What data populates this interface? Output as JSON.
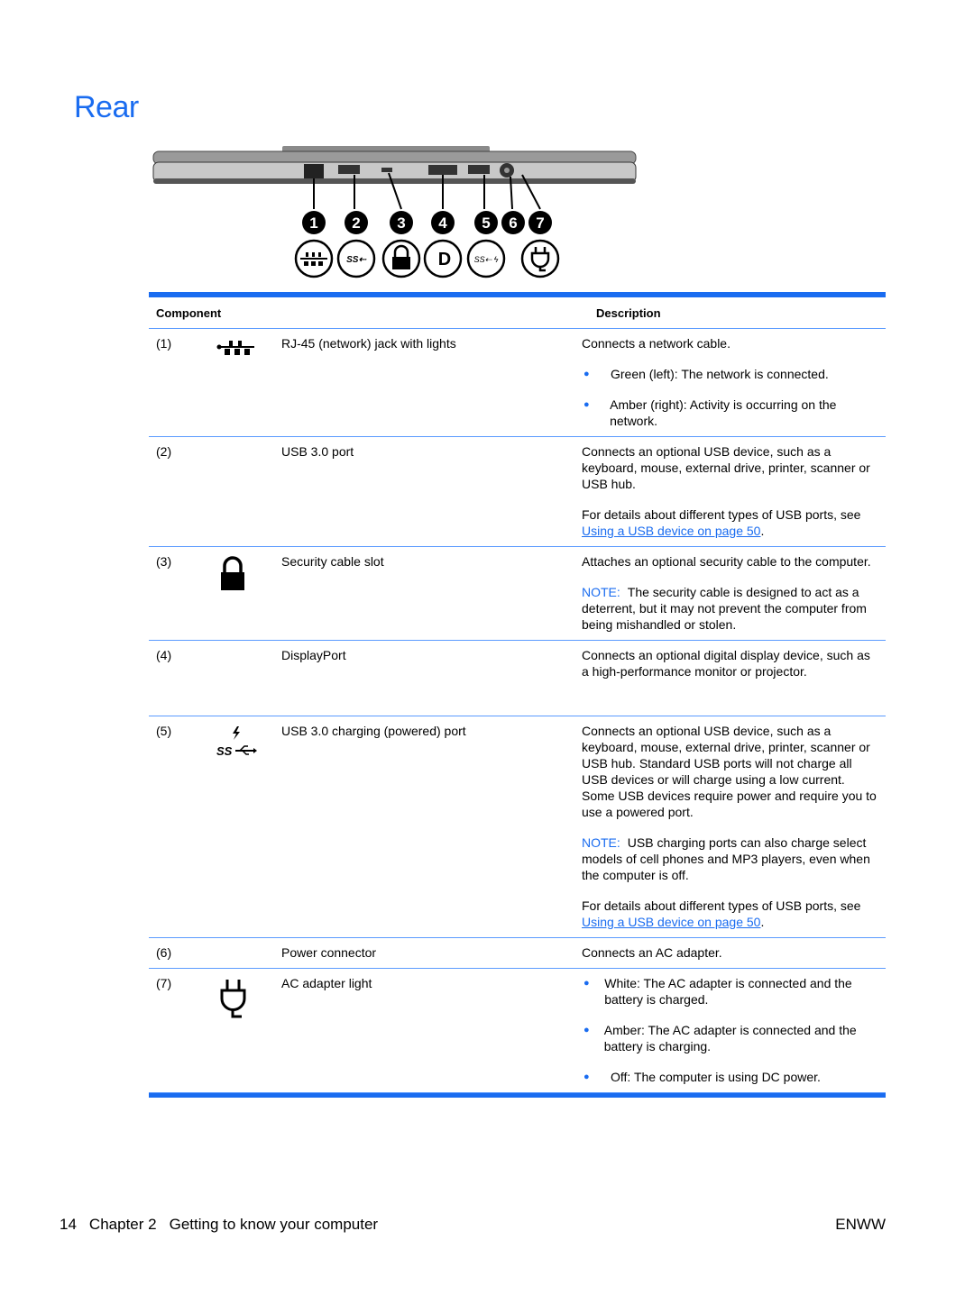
{
  "page_title": "Rear",
  "figure": {
    "callouts": [
      "1",
      "2",
      "3",
      "4",
      "5",
      "6",
      "7"
    ],
    "icons": [
      "network-jack-icon",
      "usb-3-icon",
      "lock-icon",
      "displayport-icon",
      "usb-3-charging-icon",
      "ac-plug-icon"
    ]
  },
  "table": {
    "headers": {
      "component": "Component",
      "description": "Description"
    },
    "rows": [
      {
        "num": "(1)",
        "icon": "network-jack-icon",
        "name": "RJ-45 (network) jack with lights",
        "paragraphs": [
          "Connects a network cable."
        ],
        "bullets": [
          "Green (left): The network is connected.",
          "Amber (right): Activity is occurring on the network."
        ]
      },
      {
        "num": "(2)",
        "icon": "",
        "name": "USB 3.0 port",
        "paragraphs": [
          "Connects an optional USB device, such as a keyboard, mouse, external drive, printer, scanner or USB hub."
        ],
        "link_para": {
          "prefix": "For details about different types of USB ports, see ",
          "link": "Using a USB device on page 50",
          "suffix": "."
        }
      },
      {
        "num": "(3)",
        "icon": "lock-icon",
        "name": "Security cable slot",
        "paragraphs": [
          "Attaches an optional security cable to the computer."
        ],
        "note": {
          "label": "NOTE:",
          "text": "The security cable is designed to act as a deterrent, but it may not prevent the computer from being mishandled or stolen."
        }
      },
      {
        "num": "(4)",
        "icon": "",
        "name": "DisplayPort",
        "paragraphs": [
          "Connects an optional digital display device, such as a high-performance monitor or projector."
        ]
      },
      {
        "num": "(5)",
        "icon": "usb-3-charging-icon",
        "name": "USB 3.0 charging (powered) port",
        "paragraphs": [
          "Connects an optional USB device, such as a keyboard, mouse, external drive, printer, scanner or USB hub. Standard USB ports will not charge all USB devices or will charge using a low current. Some USB devices require power and require you to use a powered port."
        ],
        "note": {
          "label": "NOTE:",
          "text": "USB charging ports can also charge select models of cell phones and MP3 players, even when the computer is off."
        },
        "link_para": {
          "prefix": "For details about different types of USB ports, see ",
          "link": "Using a USB device on page 50",
          "suffix": "."
        }
      },
      {
        "num": "(6)",
        "icon": "",
        "name": "Power connector",
        "paragraphs": [
          "Connects an AC adapter."
        ]
      },
      {
        "num": "(7)",
        "icon": "ac-plug-icon",
        "name": "AC adapter light",
        "bullets": [
          "White: The AC adapter is connected and the battery is charged.",
          "Amber: The AC adapter is connected and the battery is charging.",
          "Off: The computer is using DC power."
        ]
      }
    ]
  },
  "footer": {
    "page_number": "14",
    "chapter": "Chapter 2",
    "chapter_title": "Getting to know your computer",
    "locale": "ENWW"
  },
  "colors": {
    "accent": "#1a6cf0"
  }
}
